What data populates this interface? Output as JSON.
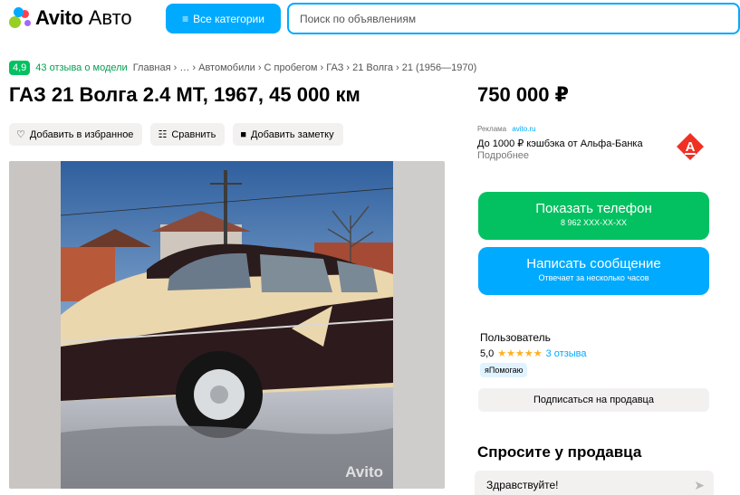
{
  "header": {
    "logo_text": "Avito",
    "logo_sub": "Авто",
    "categories_button": "Все категории",
    "search_placeholder": "Поиск по объявлениям"
  },
  "breadcrumb": {
    "rating": "4,9",
    "reviews_link": "43 отзыва о модели",
    "path": "Главная › … › Автомобили › С пробегом › ГАЗ › 21 Волга › 21 (1956—1970)"
  },
  "listing": {
    "title": "ГАЗ 21 Волга 2.4 MT, 1967, 45 000 км",
    "price": "750 000 ₽"
  },
  "actions": {
    "favorite": "Добавить в избранное",
    "compare": "Сравнить",
    "note": "Добавить заметку"
  },
  "photo": {
    "watermark": "Avito"
  },
  "ad": {
    "label": "Реклама",
    "source": "avito.ru",
    "text": "До 1000 ₽ кэшбэка от Альфа-Банка",
    "more": "Подробнее"
  },
  "contact": {
    "phone_label": "Показать телефон",
    "phone_number": "8 962 XXX-XX-XX",
    "message_label": "Написать сообщение",
    "message_sub": "Отвечает за несколько часов"
  },
  "seller": {
    "name": "Пользователь",
    "rating": "5,0",
    "stars": "★★★★★",
    "reviews": "3 отзыва",
    "badge": "яПомогаю",
    "subscribe": "Подписаться на продавца"
  },
  "ask": {
    "title": "Спросите у продавца",
    "message": "Здравствуйте!"
  },
  "colors": {
    "brand_blue": "#00aaff",
    "brand_green": "#03c160"
  }
}
